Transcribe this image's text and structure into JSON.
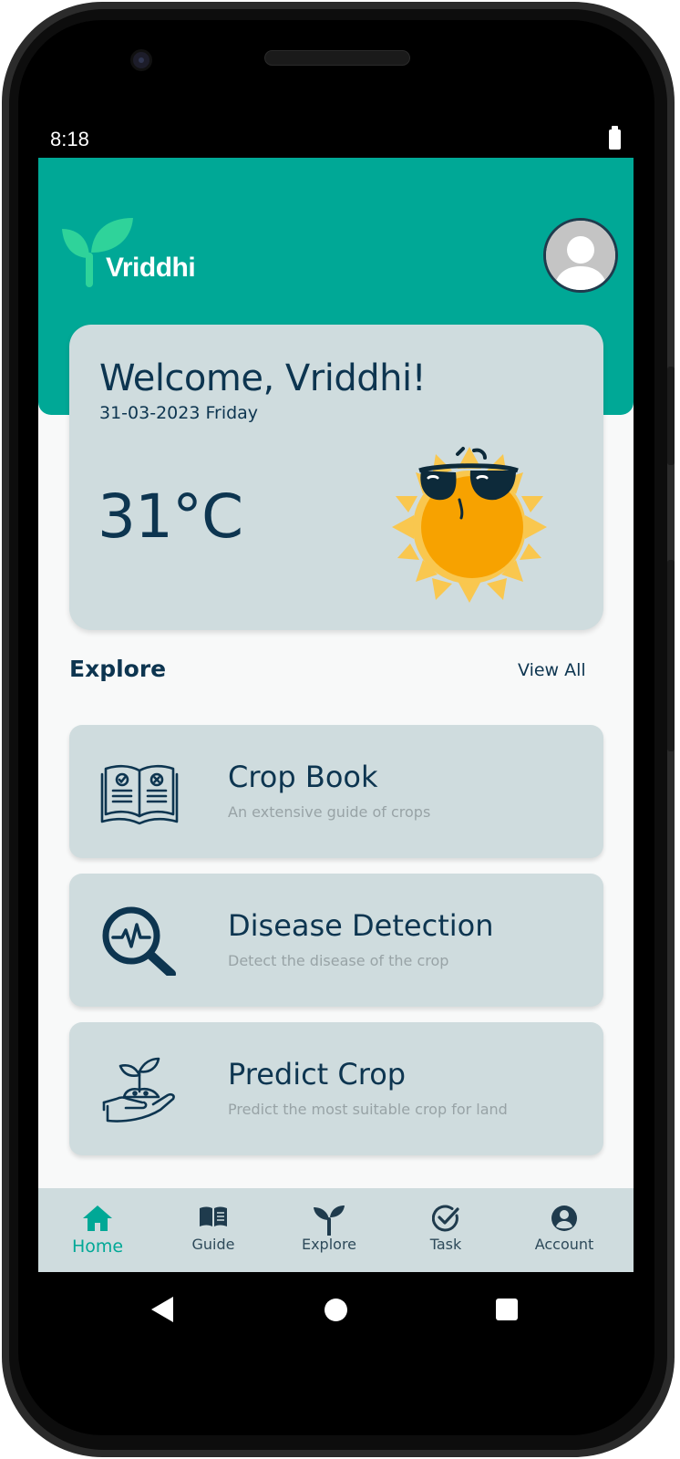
{
  "status_bar": {
    "time": "8:18"
  },
  "header": {
    "logo_text": "Vriddhi"
  },
  "weather": {
    "welcome": "Welcome, Vriddhi!",
    "date": "31-03-2023 Friday",
    "temperature": "31°C",
    "icon": "sun-with-sunglasses-icon"
  },
  "explore": {
    "title": "Explore",
    "view_all": "View All",
    "cards": [
      {
        "title": "Crop Book",
        "subtitle": "An extensive guide of crops",
        "icon": "open-book-icon"
      },
      {
        "title": "Disease Detection",
        "subtitle": "Detect the disease of the crop",
        "icon": "magnifier-pulse-icon"
      },
      {
        "title": "Predict Crop",
        "subtitle": "Predict the most suitable crop for land",
        "icon": "hand-sprout-icon"
      }
    ]
  },
  "bottom_nav": {
    "items": [
      {
        "label": "Home",
        "icon": "home-icon",
        "active": true
      },
      {
        "label": "Guide",
        "icon": "book-icon",
        "active": false
      },
      {
        "label": "Explore",
        "icon": "sprout-icon",
        "active": false
      },
      {
        "label": "Task",
        "icon": "check-circle-icon",
        "active": false
      },
      {
        "label": "Account",
        "icon": "account-circle-icon",
        "active": false
      }
    ]
  },
  "colors": {
    "brand": "#00a896",
    "card": "#cfdcde",
    "text_dark": "#0d3550",
    "text_muted": "#98a3a6",
    "sun": "#f7a200"
  }
}
